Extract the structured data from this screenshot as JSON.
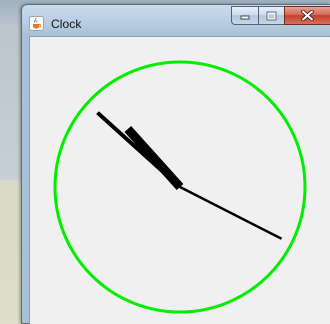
{
  "window": {
    "title": "Clock",
    "app_icon": "java-cup-icon",
    "controls": [
      "minimize-icon",
      "maximize-icon",
      "close-icon"
    ]
  },
  "clock": {
    "face_color": "#00ee00",
    "hand_color": "#000000",
    "time": {
      "hour_position": 10.6,
      "minute_position": 52.0,
      "second_position": 19.5
    }
  }
}
